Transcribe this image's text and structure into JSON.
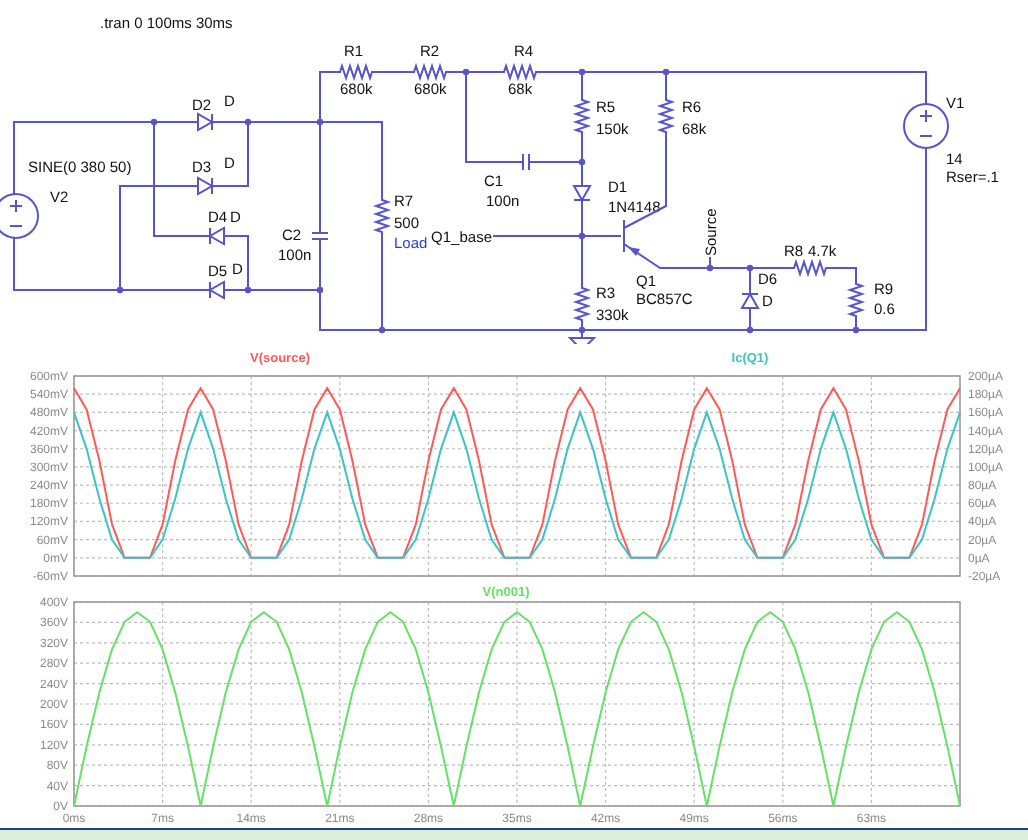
{
  "schematic": {
    "directive": ".tran 0 100ms 30ms",
    "components": [
      {
        "kind": "source",
        "ref": "V2",
        "value": "SINE(0 380 50)"
      },
      {
        "kind": "diode",
        "ref": "D2",
        "value": "D"
      },
      {
        "kind": "diode",
        "ref": "D3",
        "value": "D"
      },
      {
        "kind": "diode",
        "ref": "D4",
        "value": "D"
      },
      {
        "kind": "diode",
        "ref": "D5",
        "value": "D"
      },
      {
        "kind": "capacitor",
        "ref": "C2",
        "value": "100n"
      },
      {
        "kind": "resistor",
        "ref": "R7",
        "value": "500",
        "extra": "Load"
      },
      {
        "kind": "resistor",
        "ref": "R1",
        "value": "680k"
      },
      {
        "kind": "resistor",
        "ref": "R2",
        "value": "680k"
      },
      {
        "kind": "resistor",
        "ref": "R4",
        "value": "68k"
      },
      {
        "kind": "capacitor",
        "ref": "C1",
        "value": "100n"
      },
      {
        "kind": "resistor",
        "ref": "R5",
        "value": "150k"
      },
      {
        "kind": "resistor",
        "ref": "R6",
        "value": "68k"
      },
      {
        "kind": "diode",
        "ref": "D1",
        "value": "1N4148"
      },
      {
        "kind": "pnp",
        "ref": "Q1",
        "value": "BC857C"
      },
      {
        "kind": "resistor",
        "ref": "R3",
        "value": "330k"
      },
      {
        "kind": "diode",
        "ref": "D6",
        "value": "D"
      },
      {
        "kind": "resistor",
        "ref": "R8",
        "value": "4.7k"
      },
      {
        "kind": "resistor",
        "ref": "R9",
        "value": "0.6"
      },
      {
        "kind": "source",
        "ref": "V1",
        "value": "14",
        "extra": "Rser=.1"
      }
    ],
    "net_labels": [
      {
        "text": "Q1_base"
      },
      {
        "text": "Source"
      }
    ]
  },
  "plots": [
    {
      "chart_data": {
        "type": "line",
        "x": [
          0,
          1,
          2,
          3,
          4,
          5,
          6,
          7,
          8,
          9,
          10,
          11,
          12,
          13,
          14,
          15,
          16,
          17,
          18,
          19,
          20,
          21,
          22,
          23,
          24,
          25,
          26,
          27,
          28,
          29,
          30,
          31,
          32,
          33,
          34,
          35,
          36,
          37,
          38,
          39,
          40,
          41,
          42,
          43,
          44,
          45,
          46,
          47,
          48,
          49,
          50,
          51,
          52,
          53,
          54,
          55,
          56,
          57,
          58,
          59,
          60,
          61,
          62,
          63,
          64,
          65,
          66,
          67,
          68,
          69,
          70
        ],
        "series": [
          {
            "name": "V(source)",
            "color": "#ff5a5a",
            "values": [
              560,
              490,
              320,
              110,
              0,
              0,
              0,
              110,
              320,
              490,
              560,
              490,
              320,
              110,
              0,
              0,
              0,
              110,
              320,
              490,
              560,
              490,
              320,
              110,
              0,
              0,
              0,
              110,
              320,
              490,
              560,
              490,
              320,
              110,
              0,
              0,
              0,
              110,
              320,
              490,
              560,
              490,
              320,
              110,
              0,
              0,
              0,
              110,
              320,
              490,
              560,
              490,
              320,
              110,
              0,
              0,
              0,
              110,
              320,
              490,
              560,
              490,
              320,
              110,
              0,
              0,
              0,
              110,
              320,
              490,
              560
            ]
          },
          {
            "name": "Ic(Q1)",
            "color": "#3cc4c4",
            "axis": "y2",
            "values": [
              160,
              120,
              65,
              20,
              0,
              0,
              0,
              20,
              65,
              120,
              160,
              120,
              65,
              20,
              0,
              0,
              0,
              20,
              65,
              120,
              160,
              120,
              65,
              20,
              0,
              0,
              0,
              20,
              65,
              120,
              160,
              120,
              65,
              20,
              0,
              0,
              0,
              20,
              65,
              120,
              160,
              120,
              65,
              20,
              0,
              0,
              0,
              20,
              65,
              120,
              160,
              120,
              65,
              20,
              0,
              0,
              0,
              20,
              65,
              120,
              160,
              120,
              65,
              20,
              0,
              0,
              0,
              20,
              65,
              120,
              160
            ]
          }
        ],
        "grid": true,
        "xlim": [
          0,
          70
        ],
        "ylim": [
          -60,
          600
        ],
        "y2lim": [
          -20,
          200
        ],
        "yticks": [
          {
            "value": 600,
            "label": "600mV"
          },
          {
            "value": 540,
            "label": "540mV"
          },
          {
            "value": 480,
            "label": "480mV"
          },
          {
            "value": 420,
            "label": "420mV"
          },
          {
            "value": 360,
            "label": "360mV"
          },
          {
            "value": 300,
            "label": "300mV"
          },
          {
            "value": 240,
            "label": "240mV"
          },
          {
            "value": 180,
            "label": "180mV"
          },
          {
            "value": 120,
            "label": "120mV"
          },
          {
            "value": 60,
            "label": "60mV"
          },
          {
            "value": 0,
            "label": "0mV"
          },
          {
            "value": -60,
            "label": "-60mV"
          }
        ],
        "y2ticks": [
          {
            "value": 200,
            "label": "200µA"
          },
          {
            "value": 180,
            "label": "180µA"
          },
          {
            "value": 160,
            "label": "160µA"
          },
          {
            "value": 140,
            "label": "140µA"
          },
          {
            "value": 120,
            "label": "120µA"
          },
          {
            "value": 100,
            "label": "100µA"
          },
          {
            "value": 80,
            "label": "80µA"
          },
          {
            "value": 60,
            "label": "60µA"
          },
          {
            "value": 40,
            "label": "40µA"
          },
          {
            "value": 20,
            "label": "20µA"
          },
          {
            "value": 0,
            "label": "0µA"
          },
          {
            "value": -20,
            "label": "-20µA"
          }
        ]
      }
    },
    {
      "chart_data": {
        "type": "line",
        "x": [
          0,
          1,
          2,
          3,
          4,
          5,
          6,
          7,
          8,
          9,
          10,
          11,
          12,
          13,
          14,
          15,
          16,
          17,
          18,
          19,
          20,
          21,
          22,
          23,
          24,
          25,
          26,
          27,
          28,
          29,
          30,
          31,
          32,
          33,
          34,
          35,
          36,
          37,
          38,
          39,
          40,
          41,
          42,
          43,
          44,
          45,
          46,
          47,
          48,
          49,
          50,
          51,
          52,
          53,
          54,
          55,
          56,
          57,
          58,
          59,
          60,
          61,
          62,
          63,
          64,
          65,
          66,
          67,
          68,
          69,
          70
        ],
        "series": [
          {
            "name": "V(n001)",
            "color": "#66e066",
            "values": [
              0,
              117,
              223,
              307,
              361,
              380,
              361,
              307,
              223,
              117,
              0,
              117,
              223,
              307,
              361,
              380,
              361,
              307,
              223,
              117,
              0,
              117,
              223,
              307,
              361,
              380,
              361,
              307,
              223,
              117,
              0,
              117,
              223,
              307,
              361,
              380,
              361,
              307,
              223,
              117,
              0,
              117,
              223,
              307,
              361,
              380,
              361,
              307,
              223,
              117,
              0,
              117,
              223,
              307,
              361,
              380,
              361,
              307,
              223,
              117,
              0,
              117,
              223,
              307,
              361,
              380,
              361,
              307,
              223,
              117,
              0
            ]
          }
        ],
        "grid": true,
        "xlim": [
          0,
          70
        ],
        "ylim": [
          0,
          400
        ],
        "xticks": [
          {
            "value": 0,
            "label": "0ms"
          },
          {
            "value": 7,
            "label": "7ms"
          },
          {
            "value": 14,
            "label": "14ms"
          },
          {
            "value": 21,
            "label": "21ms"
          },
          {
            "value": 28,
            "label": "28ms"
          },
          {
            "value": 35,
            "label": "35ms"
          },
          {
            "value": 42,
            "label": "42ms"
          },
          {
            "value": 49,
            "label": "49ms"
          },
          {
            "value": 56,
            "label": "56ms"
          },
          {
            "value": 63,
            "label": "63ms"
          }
        ],
        "yticks": [
          {
            "value": 400,
            "label": "400V"
          },
          {
            "value": 360,
            "label": "360V"
          },
          {
            "value": 320,
            "label": "320V"
          },
          {
            "value": 280,
            "label": "280V"
          },
          {
            "value": 240,
            "label": "240V"
          },
          {
            "value": 200,
            "label": "200V"
          },
          {
            "value": 160,
            "label": "160V"
          },
          {
            "value": 120,
            "label": "120V"
          },
          {
            "value": 80,
            "label": "80V"
          },
          {
            "value": 40,
            "label": "40V"
          },
          {
            "value": 0,
            "label": "0V"
          }
        ]
      }
    }
  ]
}
